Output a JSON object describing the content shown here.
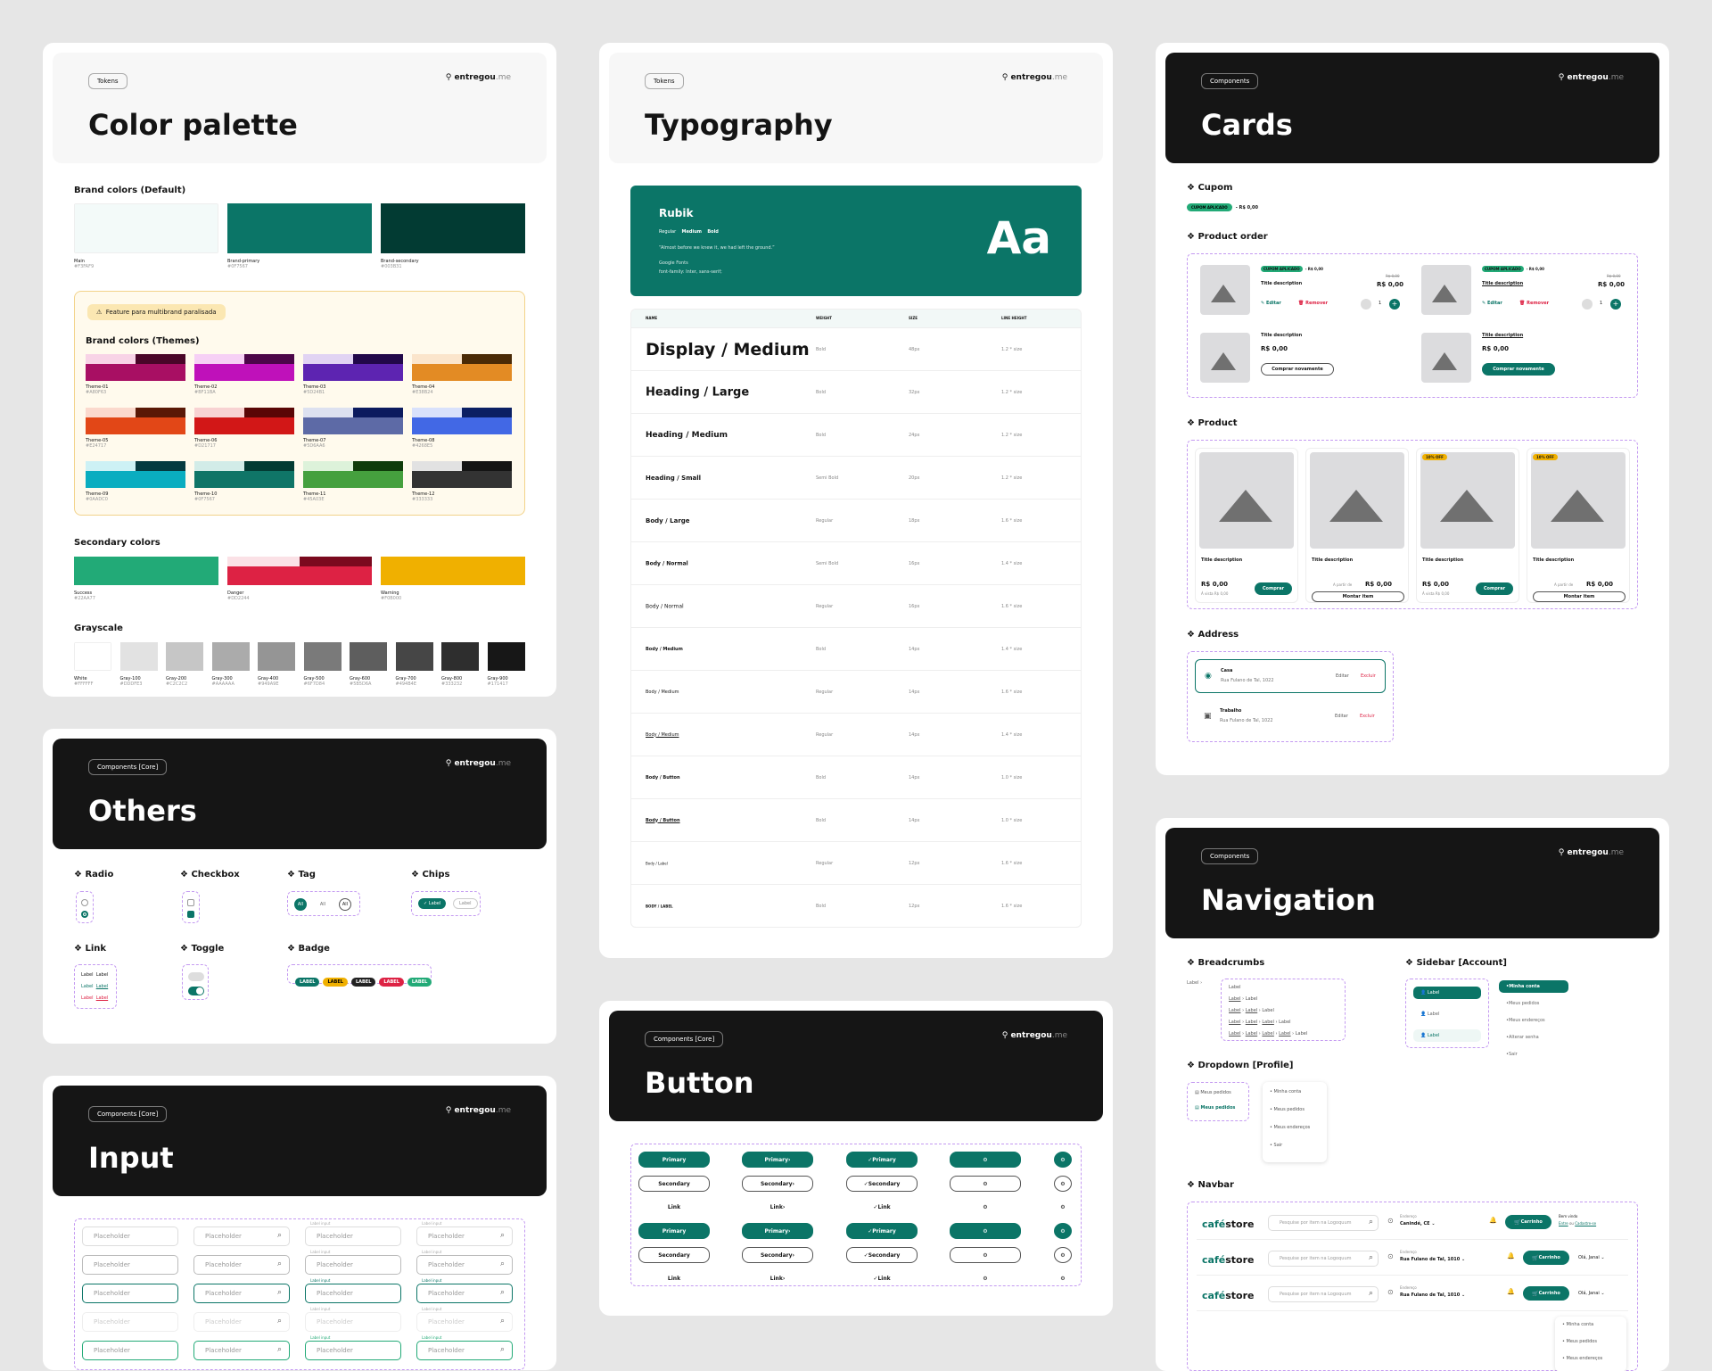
{
  "logo": {
    "name": "entregou",
    "suffix": ".me"
  },
  "color_palette": {
    "tag": "Tokens",
    "title": "Color palette",
    "brand_title": "Brand colors (Default)",
    "brand": [
      {
        "name": "Main",
        "hex": "#F3FAF9",
        "color": "#f3faf9"
      },
      {
        "name": "Brand-primary",
        "hex": "#0F7567",
        "color": "#0b7567"
      },
      {
        "name": "Brand-secondary",
        "hex": "#003B31",
        "color": "#023b33"
      }
    ],
    "notice": "Feature para multibrand paralisada",
    "themes_title": "Brand colors (Themes)",
    "themes": [
      {
        "name": "Theme-01",
        "hex": "#A80F63",
        "c": [
          "#f8d3e6",
          "#a80f63",
          "#4a0628"
        ]
      },
      {
        "name": "Theme-02",
        "hex": "#BF11BA",
        "c": [
          "#f6d0f5",
          "#bf11ba",
          "#4c0649"
        ]
      },
      {
        "name": "Theme-03",
        "hex": "#5D24B1",
        "c": [
          "#e1d3f3",
          "#5d24b1",
          "#22084a"
        ]
      },
      {
        "name": "Theme-04",
        "hex": "#E38B24",
        "c": [
          "#fbe5cc",
          "#e38b24",
          "#4a2a06"
        ]
      },
      {
        "name": "Theme-05",
        "hex": "#E24717",
        "c": [
          "#fbd9cd",
          "#e24717",
          "#5a1806"
        ]
      },
      {
        "name": "Theme-06",
        "hex": "#D21717",
        "c": [
          "#f8d2d2",
          "#d21717",
          "#5a0606"
        ]
      },
      {
        "name": "Theme-07",
        "hex": "#5D6AA6",
        "c": [
          "#dde1f0",
          "#5d6aa6",
          "#0c1a5e"
        ]
      },
      {
        "name": "Theme-08",
        "hex": "#4268E5",
        "c": [
          "#d9e1fb",
          "#4268e5",
          "#0b1f63"
        ]
      },
      {
        "name": "Theme-09",
        "hex": "#0AADC0",
        "c": [
          "#cdf1f5",
          "#0aadc0",
          "#043a40"
        ]
      },
      {
        "name": "Theme-10",
        "hex": "#0F7567",
        "c": [
          "#d2ece8",
          "#0f7567",
          "#023b33"
        ]
      },
      {
        "name": "Theme-11",
        "hex": "#45A03E",
        "c": [
          "#ddf2da",
          "#45a03e",
          "#0f3c0b"
        ]
      },
      {
        "name": "Theme-12",
        "hex": "#333333",
        "c": [
          "#e2e2e2",
          "#333333",
          "#141414"
        ]
      }
    ],
    "secondary_title": "Secondary colors",
    "secondary": [
      {
        "name": "Success",
        "hex": "#22AA77",
        "c": [
          "#22aa77"
        ]
      },
      {
        "name": "Danger",
        "hex": "#DD2244",
        "c": [
          "#fbe1e6",
          "#dd2244",
          "#7a0a1e"
        ]
      },
      {
        "name": "Warning",
        "hex": "#F0B000",
        "c": [
          "#f0b000"
        ]
      }
    ],
    "gray_title": "Grayscale",
    "grays": [
      {
        "name": "White",
        "hex": "#FFFFFF",
        "color": "#ffffff"
      },
      {
        "name": "Gray-100",
        "hex": "#DDDFE3",
        "color": "#e2e2e2"
      },
      {
        "name": "Gray-200",
        "hex": "#C2C2C2",
        "color": "#c6c6c6"
      },
      {
        "name": "Gray-300",
        "hex": "#AAAAAA",
        "color": "#ababab"
      },
      {
        "name": "Gray-400",
        "hex": "#949A9E",
        "color": "#959595"
      },
      {
        "name": "Gray-500",
        "hex": "#6F7D84",
        "color": "#7a7a7a"
      },
      {
        "name": "Gray-600",
        "hex": "#5B5D6A",
        "color": "#5e5e5e"
      },
      {
        "name": "Gray-700",
        "hex": "#494B4E",
        "color": "#464646"
      },
      {
        "name": "Gray-800",
        "hex": "#333232",
        "color": "#2e2e2e"
      },
      {
        "name": "Gray-900",
        "hex": "#171417",
        "color": "#171717"
      }
    ]
  },
  "others": {
    "tag": "Components [Core]",
    "title": "Others",
    "radio": "Radio",
    "checkbox": "Checkbox",
    "tag_label": "Tag",
    "chips": "Chips",
    "link": "Link",
    "toggle": "Toggle",
    "badge": "Badge",
    "tag_all": "All",
    "chip_label": "Label",
    "link_label": "Label",
    "badge_label": "LABEL"
  },
  "input": {
    "tag": "Components [Core]",
    "title": "Input",
    "placeholder": "Placeholder",
    "label_input": "Label input"
  },
  "typography": {
    "tag": "Tokens",
    "title": "Typography",
    "font": "Rubik",
    "weights": [
      "Regular",
      "Medium",
      "Bold"
    ],
    "quote": "“Almost before we knew it, we had left the ground.”",
    "source": "Google Fonts",
    "family": "font-family: Inter, sans-serif;",
    "aa": "Aa",
    "cols": [
      "NAME",
      "WEIGHT",
      "SIZE",
      "LINE HEIGHT"
    ],
    "rows": [
      {
        "name": "Display / Medium",
        "weight": "Bold",
        "size": "48px",
        "lh": "1.2 * size"
      },
      {
        "name": "Heading / Large",
        "weight": "Bold",
        "size": "32px",
        "lh": "1.2 * size"
      },
      {
        "name": "Heading / Medium",
        "weight": "Bold",
        "size": "24px",
        "lh": "1.2 * size"
      },
      {
        "name": "Heading / Small",
        "weight": "Semi Bold",
        "size": "20px",
        "lh": "1.2 * size"
      },
      {
        "name": "Body / Large",
        "weight": "Regular",
        "size": "18px",
        "lh": "1.6 * size"
      },
      {
        "name": "Body / Normal",
        "weight": "Semi Bold",
        "size": "16px",
        "lh": "1.4 * size"
      },
      {
        "name": "Body / Normal",
        "weight": "Regular",
        "size": "16px",
        "lh": "1.6 * size"
      },
      {
        "name": "Body / Medium",
        "weight": "Bold",
        "size": "14px",
        "lh": "1.4 * size"
      },
      {
        "name": "Body / Medium",
        "weight": "Regular",
        "size": "14px",
        "lh": "1.6 * size"
      },
      {
        "name": "Body / Medium",
        "weight": "Regular",
        "size": "14px",
        "lh": "1.4 * size"
      },
      {
        "name": "Body / Button",
        "weight": "Bold",
        "size": "14px",
        "lh": "1.0 * size"
      },
      {
        "name": "Body / Button",
        "weight": "Bold",
        "size": "14px",
        "lh": "1.0 * size"
      },
      {
        "name": "Body / Label",
        "weight": "Regular",
        "size": "12px",
        "lh": "1.6 * size"
      },
      {
        "name": "BODY / LABEL",
        "weight": "Bold",
        "size": "12px",
        "lh": "1.6 * size"
      }
    ]
  },
  "button": {
    "tag": "Components [Core]",
    "title": "Button",
    "primary": "Primary",
    "secondary": "Secondary",
    "link": "Link"
  },
  "cards": {
    "tag": "Components",
    "title": "Cards",
    "cupom": "Cupom",
    "cupom_badge": "CUPOM APLICADO",
    "cupom_value": "- R$ 0,00",
    "product_order": "Product order",
    "title_desc": "Title description",
    "old_price": "R$ 0,00",
    "price": "R$ 0,00",
    "editar": "Editar",
    "remover": "Remover",
    "qty": "1",
    "comprar_nov": "Comprar novamente",
    "product": "Product",
    "off": "10% OFF",
    "comprar": "Comprar",
    "montar": "Montar item",
    "a_vista": "À vista R$ 0,00",
    "por": "Por",
    "de": "De",
    "a_partir": "A partir de",
    "address": "Address",
    "addr": [
      {
        "name": "Casa",
        "street": "Rua Fulano de Tal, 1022"
      },
      {
        "name": "Trabalho",
        "street": "Rua Fulano de Tal, 1022"
      }
    ],
    "excluir": "Excluir"
  },
  "navigation": {
    "tag": "Components",
    "title": "Navigation",
    "breadcrumbs": "Breadcrumbs",
    "sidebar": "Sidebar [Account]",
    "label": "Label",
    "dropdown": "Dropdown [Profile]",
    "menu": [
      "Minha conta",
      "Meus pedidos",
      "Meus endereços",
      "Alterar senha",
      "Sair"
    ],
    "navbar": "Navbar",
    "store": "café",
    "store2": "store",
    "search": "Pesquise por item na Logoquum",
    "endereco": "Endereço",
    "addr1": "Canindé, CE",
    "addr2": "Rua Fulano de Tal, 1010",
    "carrinho": "Carrinho",
    "welcome": "Bem vindo",
    "entre": "Entre",
    "ou": "ou",
    "cadastre": "Cadastre-se",
    "user": "Olá, Janai"
  }
}
